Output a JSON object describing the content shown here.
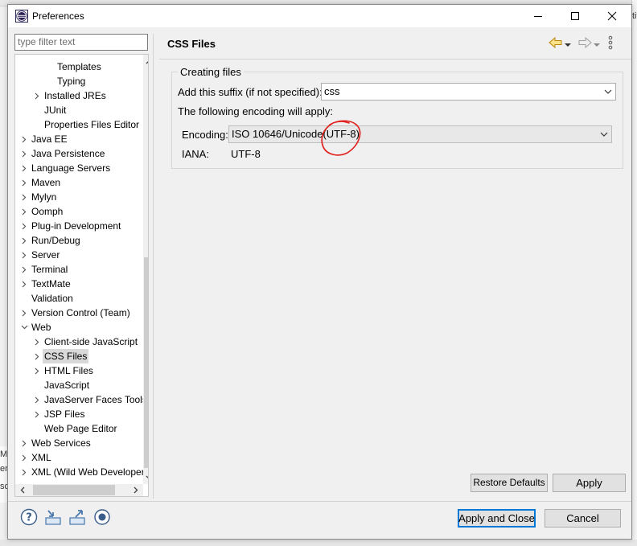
{
  "window": {
    "title": "Preferences"
  },
  "filter": {
    "placeholder": "type filter text"
  },
  "tree": [
    {
      "label": "Templates",
      "level": 3,
      "expander": "none"
    },
    {
      "label": "Typing",
      "level": 3,
      "expander": "none"
    },
    {
      "label": "Installed JREs",
      "level": 2,
      "expander": "collapsed"
    },
    {
      "label": "JUnit",
      "level": 2,
      "expander": "none"
    },
    {
      "label": "Properties Files Editor",
      "level": 2,
      "expander": "none"
    },
    {
      "label": "Java EE",
      "level": 1,
      "expander": "collapsed"
    },
    {
      "label": "Java Persistence",
      "level": 1,
      "expander": "collapsed"
    },
    {
      "label": "Language Servers",
      "level": 1,
      "expander": "collapsed"
    },
    {
      "label": "Maven",
      "level": 1,
      "expander": "collapsed"
    },
    {
      "label": "Mylyn",
      "level": 1,
      "expander": "collapsed"
    },
    {
      "label": "Oomph",
      "level": 1,
      "expander": "collapsed"
    },
    {
      "label": "Plug-in Development",
      "level": 1,
      "expander": "collapsed"
    },
    {
      "label": "Run/Debug",
      "level": 1,
      "expander": "collapsed"
    },
    {
      "label": "Server",
      "level": 1,
      "expander": "collapsed"
    },
    {
      "label": "Terminal",
      "level": 1,
      "expander": "collapsed"
    },
    {
      "label": "TextMate",
      "level": 1,
      "expander": "collapsed"
    },
    {
      "label": "Validation",
      "level": 1,
      "expander": "none"
    },
    {
      "label": "Version Control (Team)",
      "level": 1,
      "expander": "collapsed"
    },
    {
      "label": "Web",
      "level": 1,
      "expander": "expanded"
    },
    {
      "label": "Client-side JavaScript",
      "level": 2,
      "expander": "collapsed"
    },
    {
      "label": "CSS Files",
      "level": 2,
      "expander": "collapsed",
      "selected": true
    },
    {
      "label": "HTML Files",
      "level": 2,
      "expander": "collapsed"
    },
    {
      "label": "JavaScript",
      "level": 2,
      "expander": "none"
    },
    {
      "label": "JavaServer Faces Tools",
      "level": 2,
      "expander": "collapsed"
    },
    {
      "label": "JSP Files",
      "level": 2,
      "expander": "collapsed"
    },
    {
      "label": "Web Page Editor",
      "level": 2,
      "expander": "none"
    },
    {
      "label": "Web Services",
      "level": 1,
      "expander": "collapsed"
    },
    {
      "label": "XML",
      "level": 1,
      "expander": "collapsed"
    },
    {
      "label": "XML (Wild Web Developer)",
      "level": 1,
      "expander": "collapsed"
    }
  ],
  "page": {
    "title": "CSS Files",
    "group_label": "Creating files",
    "suffix_label": "Add this suffix (if not specified):",
    "suffix_value": "css",
    "encoding_note": "The following encoding will apply:",
    "encoding_label": "Encoding:",
    "encoding_value": "ISO 10646/Unicode(UTF-8)",
    "iana_label": "IANA:",
    "iana_value": "UTF-8"
  },
  "buttons": {
    "restore_defaults": "Restore Defaults",
    "apply": "Apply",
    "apply_and_close": "Apply and Close",
    "cancel": "Cancel"
  },
  "background_fragments": {
    "right": "tiv",
    "left_1": "M",
    "left_2": "em",
    "left_3": "sc"
  },
  "colors": {
    "accent": "#0078d7",
    "annotation": "#e0201c",
    "selection": "#d9d9d9"
  }
}
